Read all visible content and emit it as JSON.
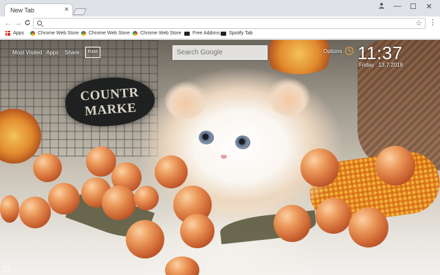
{
  "browser": {
    "tab": {
      "title": "New Tab",
      "close_glyph": "×"
    },
    "window_controls": {
      "account_icon": "account-icon",
      "minimize": "—",
      "maximize": "☐",
      "close": "✕"
    },
    "toolbar": {
      "back": "←",
      "forward": "→",
      "reload": "C",
      "omnibox": {
        "value": "",
        "placeholder": ""
      },
      "star": "☆",
      "menu": "⋮"
    },
    "bookmarks": [
      {
        "label": "Apps",
        "icon": "apps-grid-icon"
      },
      {
        "label": "Chrome Web Store",
        "icon": "chrome-web-store-icon"
      },
      {
        "label": "Chrome Web Store",
        "icon": "chrome-web-store-icon"
      },
      {
        "label": "Chrome Web Store",
        "icon": "chrome-web-store-icon"
      },
      {
        "label": "Free Addons",
        "icon": "tv-icon"
      },
      {
        "label": "Spotify Tab",
        "icon": "tv-icon"
      }
    ]
  },
  "ntp": {
    "nav": {
      "most_visited": "Most Visited",
      "apps": "Apps",
      "share": "Share",
      "rate": "Rate"
    },
    "search": {
      "placeholder": "Search Google"
    },
    "options": "Options",
    "clock": {
      "time": "11:37",
      "day": "Friday",
      "date": "13.7.2018"
    },
    "background": {
      "sign_line1": "COUNTR",
      "sign_line2": "MARKE"
    }
  },
  "colors": {
    "accent_clock_icon": "#f4a43a",
    "tabstrip": "#dee1e6"
  }
}
